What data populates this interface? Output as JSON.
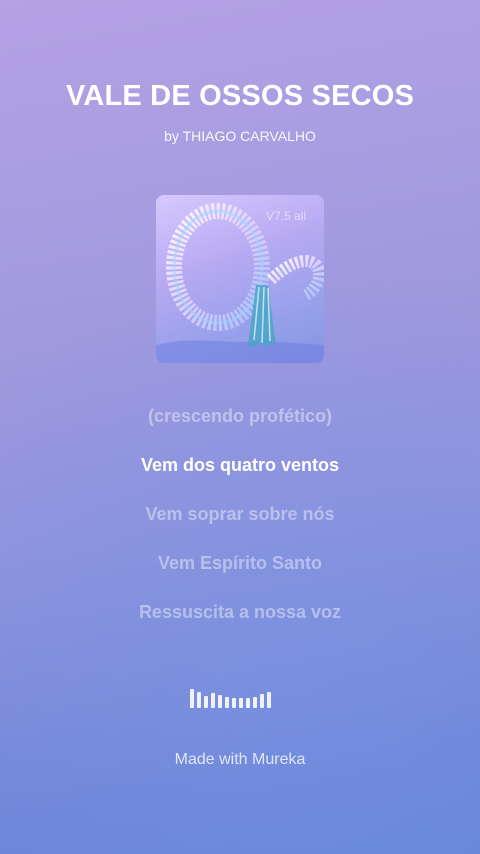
{
  "song": {
    "title": "VALE DE OSSOS SECOS",
    "artist_line": "by THIAGO CARVALHO"
  },
  "cover": {
    "icon": "album-cover-image",
    "watermark": "V7.5 all"
  },
  "lyrics": {
    "lines": [
      "(crescendo profético)",
      "Vem dos quatro ventos",
      "Vem soprar sobre nós",
      "Vem Espírito Santo",
      "Ressuscita a nossa voz"
    ],
    "active_index": 1
  },
  "visualizer": {
    "icon": "audio-visualizer-icon",
    "levels": [
      1.0,
      0.85,
      0.65,
      0.8,
      0.7,
      0.6,
      0.5,
      0.5,
      0.55,
      0.6,
      0.75,
      0.85
    ]
  },
  "footer": {
    "text": "Made with Mureka"
  }
}
